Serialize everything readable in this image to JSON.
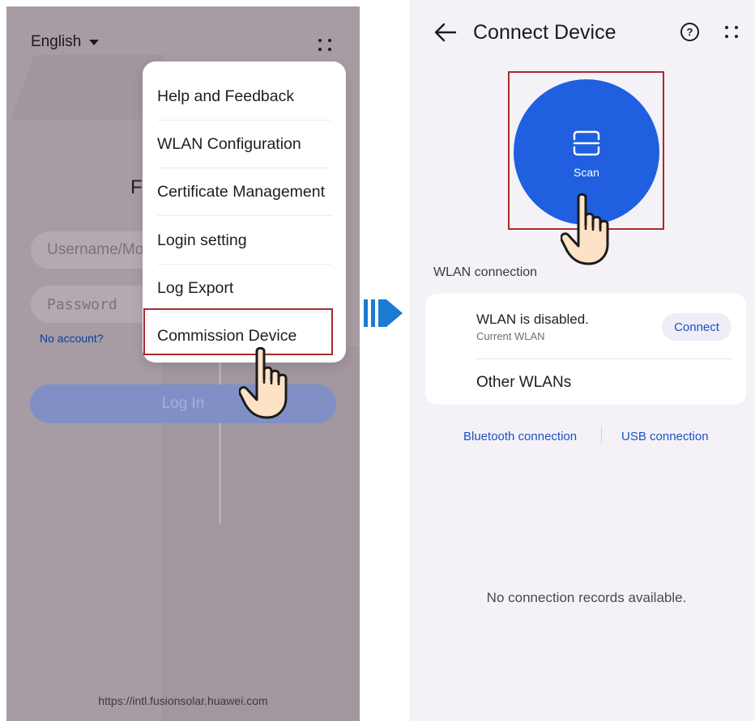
{
  "login_screen": {
    "language": "English",
    "title_partial": "F",
    "username_placeholder": "Username/Mobile",
    "password_placeholder": "Password",
    "no_account": "No account?",
    "login_button": "Log In",
    "url": "https://intl.fusionsolar.huawei.com",
    "menu": {
      "items": [
        {
          "label": "Help and Feedback"
        },
        {
          "label": "WLAN Configuration"
        },
        {
          "label": "Certificate Management"
        },
        {
          "label": "Login setting"
        },
        {
          "label": "Log Export"
        },
        {
          "label": "Commission Device"
        }
      ],
      "highlighted_item": "Commission Device"
    }
  },
  "connect_screen": {
    "header": {
      "title": "Connect Device",
      "help_symbol": "?"
    },
    "scan": {
      "label": "Scan"
    },
    "wlan_section": {
      "title": "WLAN connection",
      "status": "WLAN is disabled.",
      "current": "Current WLAN",
      "connect_button": "Connect",
      "other": "Other WLANs"
    },
    "links": {
      "bluetooth": "Bluetooth connection",
      "usb": "USB connection"
    },
    "empty_state": "No connection records available."
  },
  "colors": {
    "accent_blue": "#1f5fe0",
    "link_blue": "#1f4fc9",
    "highlight_red": "#a72b2e",
    "arrow_blue": "#1a7bd0",
    "overlay": "#a79ba4"
  },
  "icons": [
    "caret-down-icon",
    "more-icon",
    "pointing-hand-icon",
    "double-arrow-right-icon",
    "back-arrow-icon",
    "help-icon",
    "scan-icon"
  ]
}
